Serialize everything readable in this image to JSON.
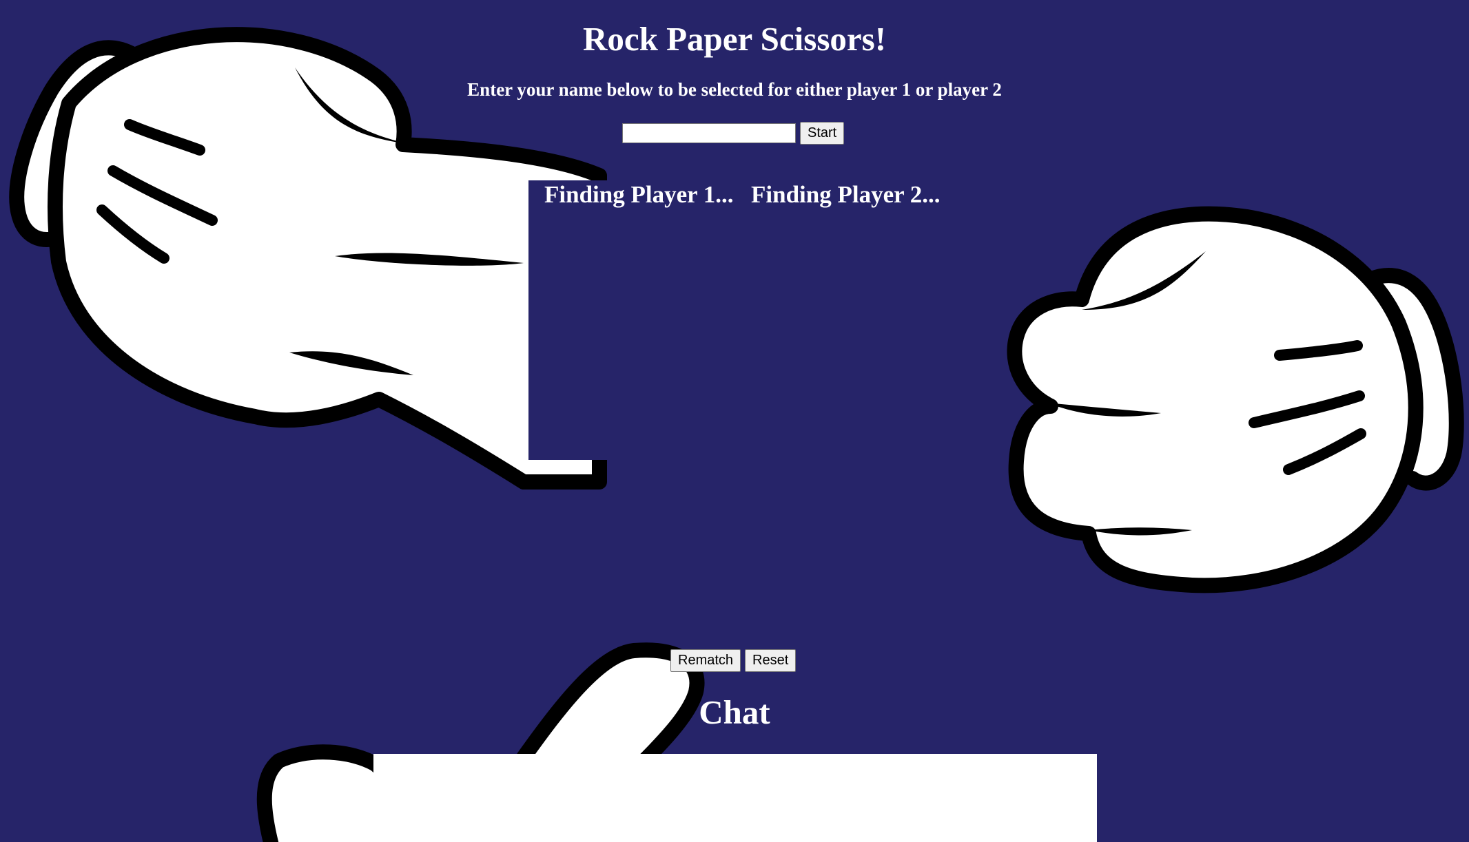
{
  "page": {
    "title": "Rock Paper Scissors!",
    "subtitle": "Enter your name below to be selected for either player 1 or player 2"
  },
  "name_form": {
    "input_value": "",
    "placeholder": "",
    "start_label": "Start"
  },
  "players": {
    "player1_label": "Finding Player 1...",
    "player2_label": "Finding Player 2..."
  },
  "controls": {
    "rematch_label": "Rematch",
    "reset_label": "Reset"
  },
  "chat": {
    "heading": "Chat"
  },
  "colors": {
    "background": "#262469",
    "text": "#ffffff",
    "hand_fill": "#ffffff",
    "hand_outline": "#000000"
  },
  "icons": {
    "left_hand": "paper-hand-icon",
    "right_hand": "rock-fist-icon",
    "bottom_hand": "pointing-hand-icon"
  }
}
